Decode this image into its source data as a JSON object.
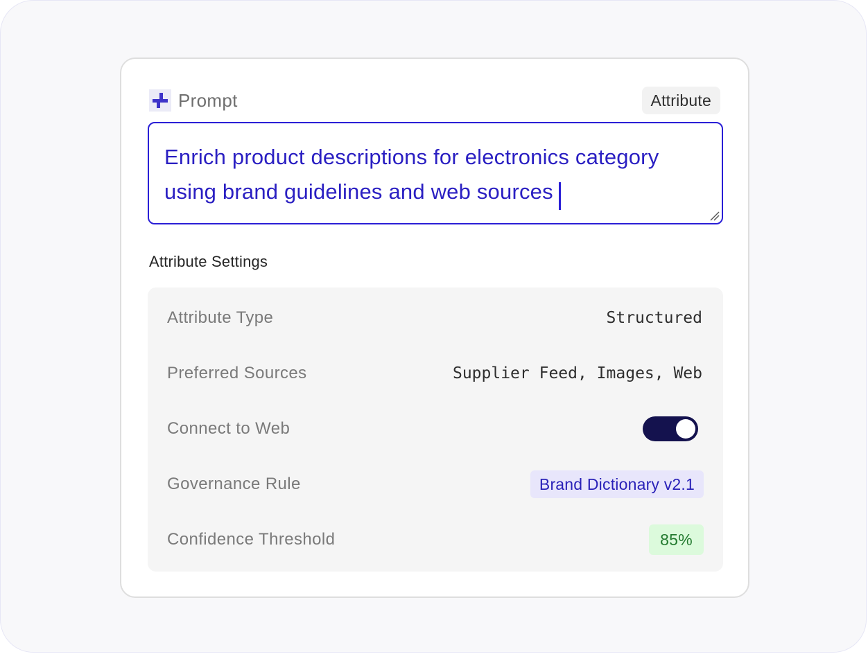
{
  "prompt": {
    "label": "Prompt",
    "icon": "sparkle-plus-icon",
    "tag": "Attribute",
    "text": "Enrich product descriptions for electronics category using brand guidelines and web sources"
  },
  "settings": {
    "title": "Attribute Settings",
    "attribute_type": {
      "label": "Attribute Type",
      "value": "Structured"
    },
    "preferred_sources": {
      "label": "Preferred Sources",
      "value": "Supplier Feed, Images, Web"
    },
    "connect_to_web": {
      "label": "Connect to Web",
      "enabled": true
    },
    "governance_rule": {
      "label": "Governance Rule",
      "value": "Brand Dictionary v2.1"
    },
    "confidence_threshold": {
      "label": "Confidence Threshold",
      "value": "85%"
    }
  },
  "colors": {
    "accent": "#2a1fd6",
    "toggle_on": "#14124e",
    "badge_blue_bg": "#e8e6fb",
    "badge_green_bg": "#dcfadc"
  }
}
